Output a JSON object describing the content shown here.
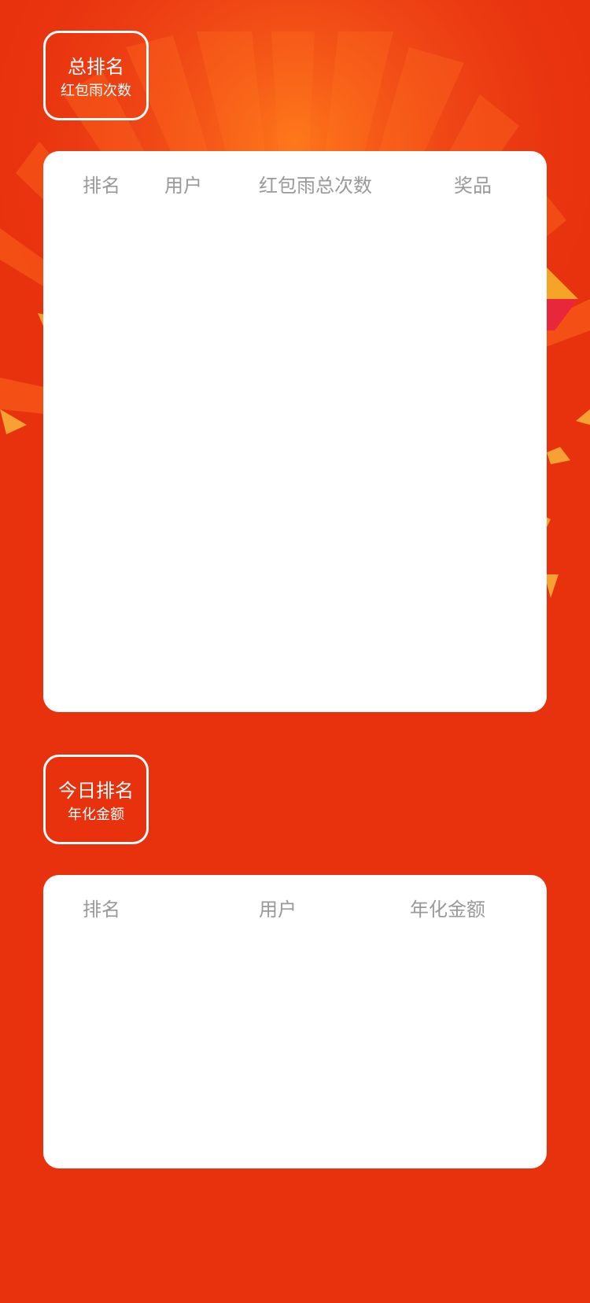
{
  "colors": {
    "background": "#e8320e",
    "card": "#ffffff",
    "header_text": "#999999",
    "badge_text": "#ffffff"
  },
  "total_ranking": {
    "title": "总排名",
    "subtitle": "红包雨次数",
    "columns": [
      "排名",
      "用户",
      "红包雨总次数",
      "奖品"
    ],
    "rows": []
  },
  "today_ranking": {
    "title": "今日排名",
    "subtitle": "年化金额",
    "columns": [
      "排名",
      "用户",
      "年化金额"
    ],
    "rows": []
  }
}
